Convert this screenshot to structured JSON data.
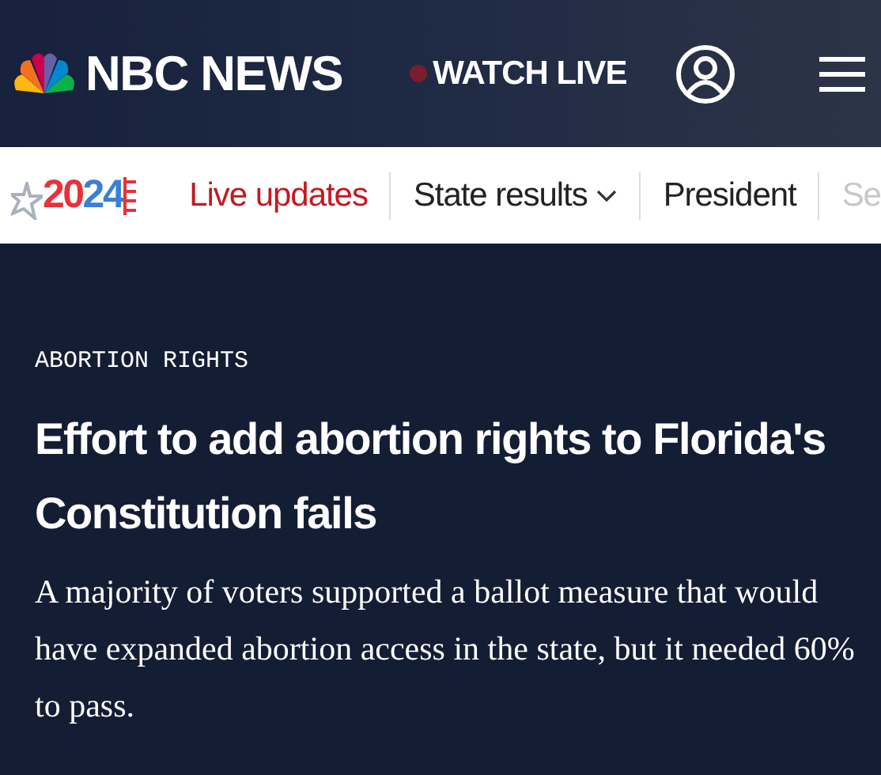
{
  "header": {
    "brand": "NBC NEWS",
    "watch_live": "WATCH LIVE"
  },
  "nav": {
    "logo_year": "2024",
    "items": [
      {
        "label": "Live updates",
        "kind": "live"
      },
      {
        "label": "State results",
        "kind": "dropdown"
      },
      {
        "label": "President",
        "kind": "plain"
      },
      {
        "label": "Se",
        "kind": "faded"
      }
    ]
  },
  "article": {
    "section": "ABORTION RIGHTS",
    "headline": "Effort to add abortion rights to Florida's Constitution fails",
    "dek": "A majority of voters supported a ballot measure that would have expanded abortion access in the state, but it needed 60% to pass."
  }
}
